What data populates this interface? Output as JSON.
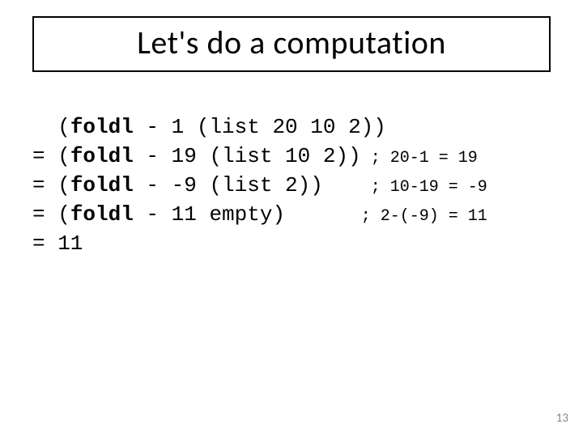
{
  "title": "Let's do a computation",
  "lines": [
    {
      "pre": "  (",
      "kw": "foldl",
      "post": " - 1 (list 20 10 2))",
      "cmt": ""
    },
    {
      "pre": "= (",
      "kw": "foldl",
      "post": " - 19 (list 10 2))",
      "cmt": " ; 20-1 = 19"
    },
    {
      "pre": "= (",
      "kw": "foldl",
      "post": " - -9 (list 2))   ",
      "cmt": " ; 10-19 = -9"
    },
    {
      "pre": "= (",
      "kw": "foldl",
      "post": " - 11 empty)      ",
      "cmt": "; 2-(-9) = 11"
    },
    {
      "pre": "= 11",
      "kw": "",
      "post": "",
      "cmt": ""
    }
  ],
  "page_number": "13"
}
